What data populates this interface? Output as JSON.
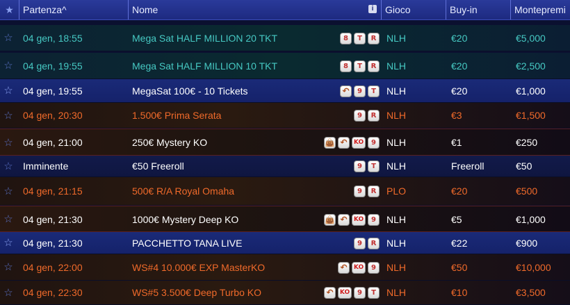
{
  "header": {
    "start": "Partenza^",
    "name": "Nome",
    "info_icon": "i",
    "game": "Gioco",
    "buyin": "Buy-in",
    "prize": "Montepremi"
  },
  "badge_icons": {
    "8": "8",
    "T": "T",
    "R": "R",
    "9": "9",
    "KO": "KO",
    "rebuy": "↶",
    "bag": "👜"
  },
  "rows": [
    {
      "theme": "teal",
      "date": "04 gen, 18:55",
      "name": "Mega Sat HALF MILLION 20 TKT",
      "badges": [
        "8",
        "T",
        "R"
      ],
      "game": "NLH",
      "buyin": "€20",
      "prize": "€5,000"
    },
    {
      "theme": "teal",
      "date": "04 gen, 19:55",
      "name": "Mega Sat HALF MILLION 10 TKT",
      "badges": [
        "8",
        "T",
        "R"
      ],
      "game": "NLH",
      "buyin": "€20",
      "prize": "€2,500"
    },
    {
      "theme": "blue",
      "date": "04 gen, 19:55",
      "name": "MegaSat 100€ - 10 Tickets",
      "badges": [
        "rebuy",
        "9",
        "T"
      ],
      "game": "NLH",
      "buyin": "€20",
      "prize": "€1,000"
    },
    {
      "theme": "orange",
      "date": "04 gen, 20:30",
      "name": "1.500€ Prima Serata",
      "badges": [
        "9",
        "R"
      ],
      "game": "NLH",
      "buyin": "€3",
      "prize": "€1,500"
    },
    {
      "theme": "mystery",
      "date": "04 gen, 21:00",
      "name": "250€ Mystery KO",
      "badges": [
        "bag",
        "rebuy",
        "KO",
        "9"
      ],
      "game": "NLH",
      "buyin": "€1",
      "prize": "€250"
    },
    {
      "theme": "navy",
      "date": "Imminente",
      "name": "€50 Freeroll",
      "badges": [
        "9",
        "T"
      ],
      "game": "NLH",
      "buyin": "Freeroll",
      "prize": "€50"
    },
    {
      "theme": "orange",
      "date": "04 gen, 21:15",
      "name": "500€ R/A Royal Omaha",
      "badges": [
        "9",
        "R"
      ],
      "game": "PLO",
      "buyin": "€20",
      "prize": "€500"
    },
    {
      "theme": "mystery",
      "date": "04 gen, 21:30",
      "name": "1000€ Mystery Deep KO",
      "badges": [
        "bag",
        "rebuy",
        "KO",
        "9"
      ],
      "game": "NLH",
      "buyin": "€5",
      "prize": "€1,000"
    },
    {
      "theme": "blue",
      "date": "04 gen, 21:30",
      "name": "PACCHETTO TANA LIVE",
      "badges": [
        "9",
        "R"
      ],
      "game": "NLH",
      "buyin": "€22",
      "prize": "€900"
    },
    {
      "theme": "orange",
      "date": "04 gen, 22:00",
      "name": "WS#4 10.000€ EXP MasterKO",
      "badges": [
        "rebuy",
        "KO",
        "9"
      ],
      "game": "NLH",
      "buyin": "€50",
      "prize": "€10,000"
    },
    {
      "theme": "orange",
      "date": "04 gen, 22:30",
      "name": "WS#5 3.500€ Deep Turbo KO",
      "badges": [
        "rebuy",
        "KO",
        "9",
        "T"
      ],
      "game": "NLH",
      "buyin": "€10",
      "prize": "€3,500"
    }
  ]
}
